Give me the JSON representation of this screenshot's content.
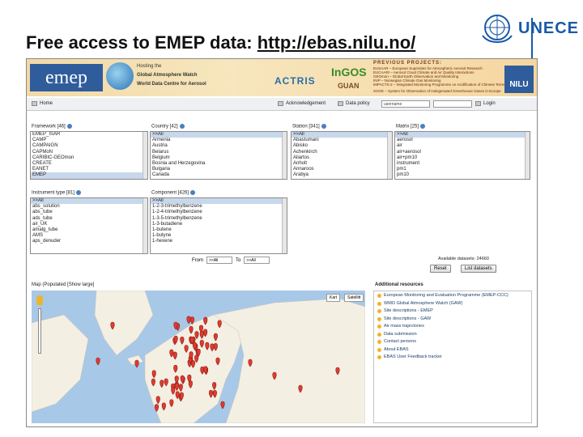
{
  "slide": {
    "title_prefix": "Free access to EMEP data: ",
    "title_link": "http://ebas.nilu.no/",
    "org_logo_text": "UNECE"
  },
  "banner": {
    "emep_logo": "emep",
    "hosting_lines": [
      "Hosting the",
      "Global Atmosphere Watch",
      "World Data Centre for Aerosol"
    ],
    "actris": "ACTRIS",
    "ingos": "InGOS",
    "guan": "GUAN",
    "previous_projects_title": "PREVIOUS PROJECTS:",
    "previous_projects": [
      "EUSAAR – European Supersites for Atmospheric Aerosol Research",
      "EUCAARI – Aerosol Cloud Climate and Air Quality Interactions",
      "GEOmon – Global Earth Observation and Monitoring",
      "INIP – Norwegian Climate Gas Monitoring",
      "IMPACTS-2 – Integrated Monitoring Programme on Acidification of Chinese Terrestrial Systems",
      "SOGE – System for Observation of Halogenated Greenhouse Gases in Europe"
    ],
    "nilu_logo": "NILU"
  },
  "toolbar": {
    "home": "Home",
    "acknowledgement": "Acknowledgement",
    "data_policy": "Data policy",
    "username_placeholder": "username",
    "login": "Login"
  },
  "filters": {
    "framework": {
      "label": "Framework [46]",
      "options": [
        "EMEP_ISAR",
        "CAMP",
        "CAMPAIGN",
        "CAPMoN",
        "CARIBIC-GEOmon",
        "CREATE",
        "EANET",
        "EMEP"
      ]
    },
    "country": {
      "label": "Country [42]",
      "options": [
        ">>All",
        "Armenia",
        "Austria",
        "Belarus",
        "Belgium",
        "Bosnia and Herzegovina",
        "Bulgaria",
        "Canada"
      ]
    },
    "station": {
      "label": "Station [341]",
      "options": [
        ">>All",
        "Abastumani",
        "Abisko",
        "Achenkirch",
        "Aliartos",
        "Anholt",
        "Annaroos",
        "Arabya"
      ]
    },
    "matrix": {
      "label": "Matrix [25]",
      "options": [
        ">>All",
        "aerosol",
        "air",
        "air+aerosol",
        "air+pm10",
        "instrument",
        "pm1",
        "pm10"
      ]
    },
    "instrument": {
      "label": "Instrument type [81]",
      "options": [
        ">>All",
        "abs_solution",
        "abs_tube",
        "ads_tube",
        "air_UK",
        "amalg_tube",
        "AMS",
        "aps_denuder"
      ]
    },
    "component": {
      "label": "Component [426]",
      "options": [
        ">>All",
        "1-2-3-trimethylbenzene",
        "1-2-4-trimethylbenzene",
        "1-3-5-trimethylbenzene",
        "1-3-butadiene",
        "1-butene",
        "1-butyne",
        "1-hexene"
      ]
    }
  },
  "period": {
    "from_label": "From",
    "from_value": ">>All",
    "to_label": "To",
    "to_value": ">>All"
  },
  "actions": {
    "available_label": "Available datasets:",
    "available_count": "24660",
    "reset": "Reset",
    "list_datasets": "List datasets"
  },
  "map": {
    "title": "Map (Populated [Show large]",
    "map_type_map": "Kart",
    "map_type_sat": "Satellitt"
  },
  "resources": {
    "title": "Additional resources",
    "items": [
      "European Monitoring and Evaluation Programme (EMEP-CCC)",
      "WMO Global Atmosphere Watch (GAW)",
      "Site descriptions - EMEP",
      "Site descriptions - GAW",
      "Air mass trajectories",
      "Data submission",
      "Contact persons",
      "About EBAS",
      "EBAS User Feedback tracker"
    ]
  },
  "colors": {
    "accent": "#2f5d9c",
    "marker": "#e03b2f",
    "ocean": "#a8c8e8",
    "land": "#f3efe3"
  }
}
